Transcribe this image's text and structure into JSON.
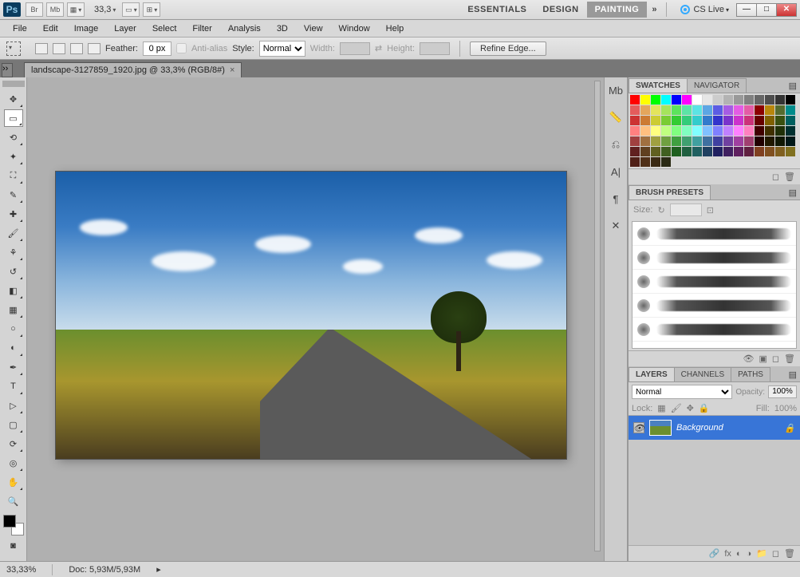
{
  "app": {
    "logo": "Ps",
    "zoom_display": "33,3",
    "cs_live": "CS Live"
  },
  "mini_buttons": [
    "Br",
    "Mb"
  ],
  "workspaces": {
    "items": [
      "ESSENTIALS",
      "DESIGN",
      "PAINTING"
    ],
    "active": 2
  },
  "menu": [
    "File",
    "Edit",
    "Image",
    "Layer",
    "Select",
    "Filter",
    "Analysis",
    "3D",
    "View",
    "Window",
    "Help"
  ],
  "options": {
    "feather_label": "Feather:",
    "feather_value": "0 px",
    "antialias_label": "Anti-alias",
    "style_label": "Style:",
    "style_value": "Normal",
    "width_label": "Width:",
    "height_label": "Height:",
    "refine_label": "Refine Edge..."
  },
  "document": {
    "tab_title": "landscape-3127859_1920.jpg @ 33,3% (RGB/8#)"
  },
  "tools": [
    "move",
    "marquee",
    "lasso",
    "wand",
    "crop",
    "eyedropper",
    "heal",
    "brush",
    "stamp",
    "history",
    "eraser",
    "gradient",
    "blur",
    "dodge",
    "pen",
    "type",
    "path-select",
    "rectangle",
    "hand",
    "zoom",
    "3d-rotate",
    "3d-orbit"
  ],
  "active_tool": "marquee",
  "dock_icons": [
    "Mb-icon",
    "ruler-icon",
    "nav-icon",
    "char-icon",
    "para-icon",
    "settings-icon"
  ],
  "swatches_panel": {
    "tabs": [
      "SWATCHES",
      "NAVIGATOR"
    ],
    "active": 0,
    "colors": [
      "#ff0000",
      "#ffff00",
      "#00ff00",
      "#00ffff",
      "#0000ff",
      "#ff00ff",
      "#ffffff",
      "#e6e6e6",
      "#cccccc",
      "#b3b3b3",
      "#999999",
      "#808080",
      "#666666",
      "#4d4d4d",
      "#333333",
      "#000000",
      "#e45c5c",
      "#e4a65c",
      "#e4e45c",
      "#a6e45c",
      "#5ce45c",
      "#5ce4a6",
      "#5ce4e4",
      "#5ca6e4",
      "#5c5ce4",
      "#a65ce4",
      "#e45ce4",
      "#e45ca6",
      "#8b0000",
      "#b8860b",
      "#556b2f",
      "#008b8b",
      "#cc3333",
      "#cc7a33",
      "#cccc33",
      "#7acc33",
      "#33cc33",
      "#33cc7a",
      "#33cccc",
      "#337acc",
      "#3333cc",
      "#7a33cc",
      "#cc33cc",
      "#cc337a",
      "#660000",
      "#806000",
      "#3a5010",
      "#006060",
      "#ff8080",
      "#ffc080",
      "#ffff80",
      "#c0ff80",
      "#80ff80",
      "#80ffc0",
      "#80ffff",
      "#80c0ff",
      "#8080ff",
      "#c080ff",
      "#ff80ff",
      "#ff80c0",
      "#400000",
      "#403000",
      "#203008",
      "#003030",
      "#a04040",
      "#a07040",
      "#a0a040",
      "#70a040",
      "#40a040",
      "#40a070",
      "#40a0a0",
      "#4070a0",
      "#4040a0",
      "#7040a0",
      "#a040a0",
      "#a04070",
      "#200000",
      "#201800",
      "#101804",
      "#001818",
      "#602020",
      "#604020",
      "#606020",
      "#406020",
      "#206020",
      "#206040",
      "#206060",
      "#204060",
      "#202060",
      "#402060",
      "#602060",
      "#602040",
      "#804020",
      "#805020",
      "#806020",
      "#807020",
      "#502018",
      "#503018",
      "#3a2a14",
      "#2a2a14"
    ]
  },
  "brush_panel": {
    "tab": "BRUSH PRESETS",
    "size_label": "Size:",
    "brushes": [
      1,
      2,
      3,
      4,
      5
    ]
  },
  "layers_panel": {
    "tabs": [
      "LAYERS",
      "CHANNELS",
      "PATHS"
    ],
    "active": 0,
    "blend": "Normal",
    "opacity_label": "Opacity:",
    "opacity": "100%",
    "lock_label": "Lock:",
    "fill_label": "Fill:",
    "fill": "100%",
    "items": [
      {
        "name": "Background",
        "locked": true
      }
    ]
  },
  "status": {
    "zoom": "33,33%",
    "doc": "Doc: 5,93M/5,93M"
  }
}
